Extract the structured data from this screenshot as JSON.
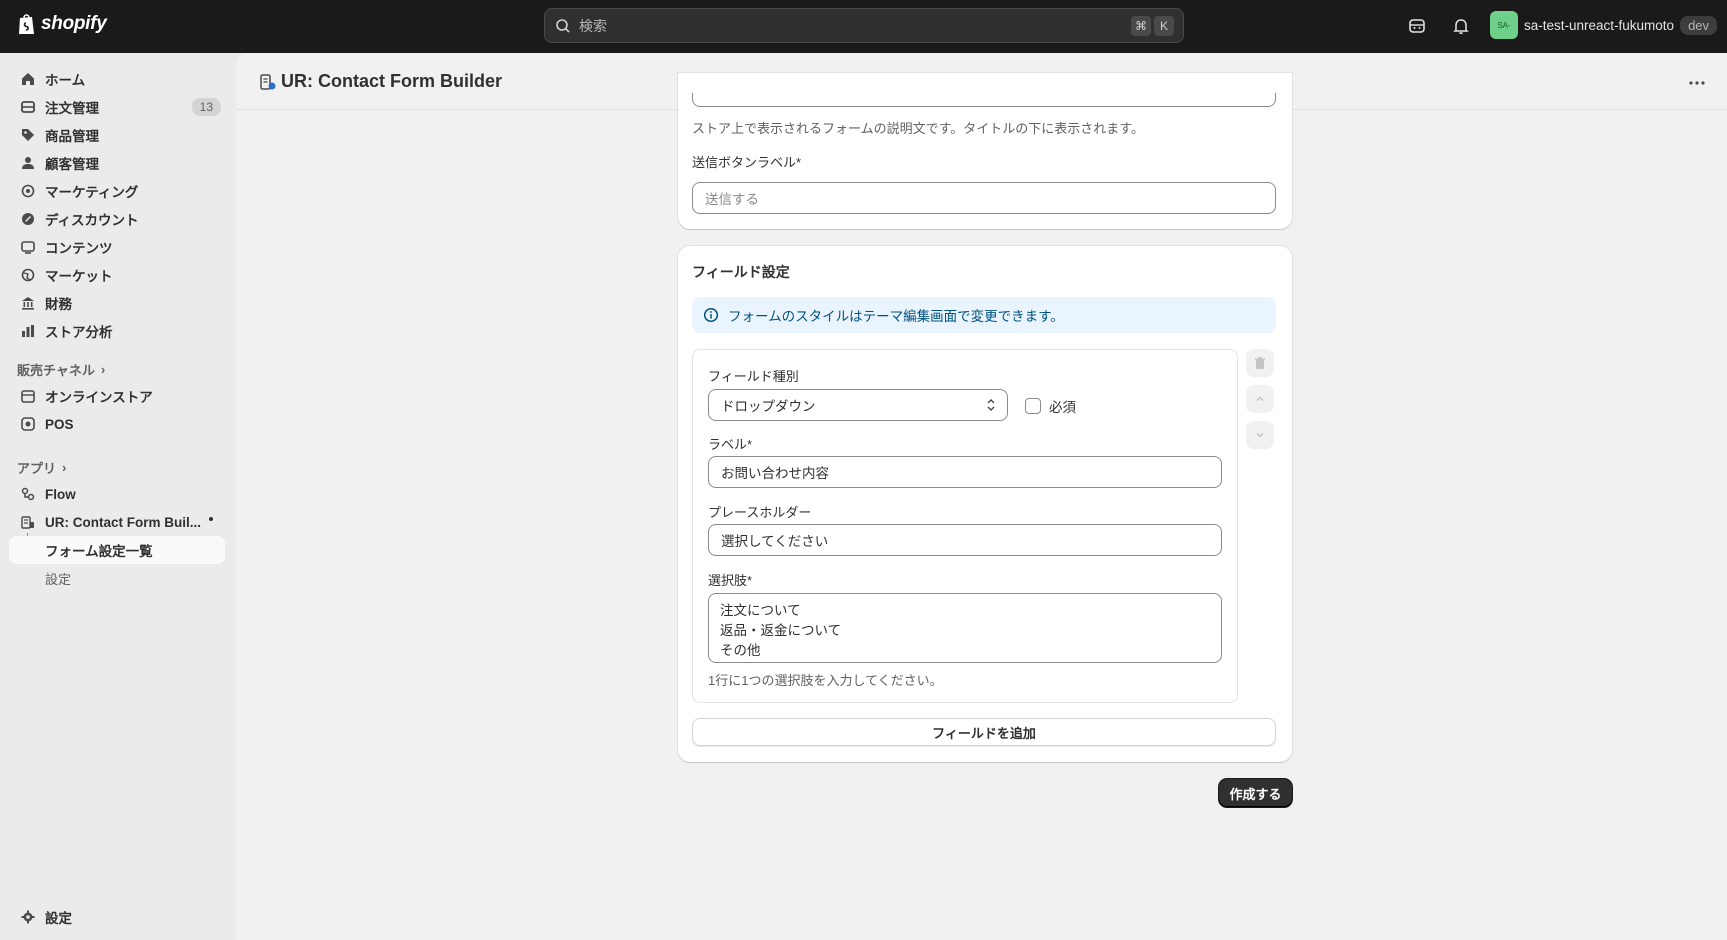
{
  "topbar": {
    "logo_text": "shopify",
    "search_placeholder": "検索",
    "shortcut_cmd": "⌘",
    "shortcut_key": "K",
    "store_avatar": "SA-",
    "store_name": "sa-test-unreact-fukumoto",
    "store_badge": "dev"
  },
  "sidebar": {
    "items": [
      {
        "label": "ホーム",
        "icon": "home-icon"
      },
      {
        "label": "注文管理",
        "icon": "orders-icon",
        "count": "13"
      },
      {
        "label": "商品管理",
        "icon": "tag-icon"
      },
      {
        "label": "顧客管理",
        "icon": "person-icon"
      },
      {
        "label": "マーケティング",
        "icon": "target-icon"
      },
      {
        "label": "ディスカウント",
        "icon": "discount-icon"
      },
      {
        "label": "コンテンツ",
        "icon": "content-icon"
      },
      {
        "label": "マーケット",
        "icon": "globe-icon"
      },
      {
        "label": "財務",
        "icon": "bank-icon"
      },
      {
        "label": "ストア分析",
        "icon": "chart-icon"
      }
    ],
    "sales_channels_title": "販売チャネル",
    "channels": [
      {
        "label": "オンラインストア",
        "icon": "store-icon"
      },
      {
        "label": "POS",
        "icon": "pos-icon"
      }
    ],
    "apps_title": "アプリ",
    "apps": [
      {
        "label": "Flow",
        "icon": "flow-icon"
      },
      {
        "label": "UR: Contact Form Buil...",
        "icon": "app-icon"
      }
    ],
    "app_sub_items": [
      {
        "label": "フォーム設定一覧"
      },
      {
        "label": "設定"
      }
    ],
    "settings_label": "設定"
  },
  "page": {
    "title": "UR: Contact Form Builder"
  },
  "form_card": {
    "description_help": "ストア上で表示されるフォームの説明文です。タイトルの下に表示されます。",
    "submit_label_title": "送信ボタンラベル*",
    "submit_label_placeholder": "送信する"
  },
  "field_settings": {
    "title": "フィールド設定",
    "banner_text": "フォームのスタイルはテーマ編集画面で変更できます。",
    "field_type_label": "フィールド種別",
    "field_type_value": "ドロップダウン",
    "required_label": "必須",
    "label_title": "ラベル*",
    "label_value": "お問い合わせ内容",
    "placeholder_title": "プレースホルダー",
    "placeholder_value": "選択してください",
    "options_title": "選択肢*",
    "options": [
      "注文について",
      "返品・返金について",
      "その他"
    ],
    "options_help": "1行に1つの選択肢を入力してください。",
    "add_field_label": "フィールドを追加"
  },
  "create_button_label": "作成する",
  "colors": {
    "topbar_bg": "#1a1a1a",
    "banner_bg": "#eaf4ff",
    "banner_text": "#00527c",
    "primary_button": "#303030",
    "avatar_bg": "#6fd089"
  }
}
